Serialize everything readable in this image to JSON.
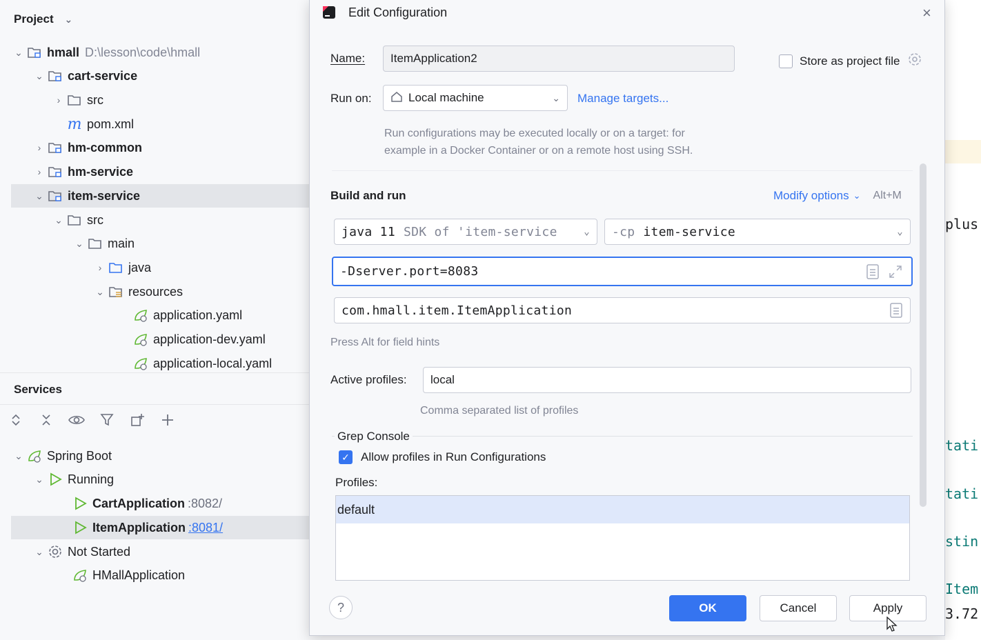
{
  "project_panel": {
    "title": "Project",
    "tree": [
      {
        "label": "hmall",
        "path": "D:\\lesson\\code\\hmall"
      },
      {
        "label": "cart-service"
      },
      {
        "label": "src"
      },
      {
        "label": "pom.xml"
      },
      {
        "label": "hm-common"
      },
      {
        "label": "hm-service"
      },
      {
        "label": "item-service"
      },
      {
        "label": "src"
      },
      {
        "label": "main"
      },
      {
        "label": "java"
      },
      {
        "label": "resources"
      },
      {
        "label": "application.yaml"
      },
      {
        "label": "application-dev.yaml"
      },
      {
        "label": "application-local.yaml"
      }
    ]
  },
  "services_panel": {
    "title": "Services",
    "tree": [
      {
        "label": "Spring Boot"
      },
      {
        "label": "Running"
      },
      {
        "label": "CartApplication",
        "port": ":8082/"
      },
      {
        "label": "ItemApplication",
        "port": ":8081/"
      },
      {
        "label": "Not Started"
      },
      {
        "label": "HMallApplication"
      }
    ]
  },
  "dialog": {
    "title": "Edit Configuration",
    "name_label": "Name:",
    "name_value": "ItemApplication2",
    "store_label": "Store as project file",
    "run_on_label": "Run on:",
    "run_on_value": "Local machine",
    "manage_targets": "Manage targets...",
    "run_on_hint_1": "Run configurations may be executed locally or on a target: for",
    "run_on_hint_2": "example in a Docker Container or on a remote host using SSH.",
    "build_run_title": "Build and run",
    "modify_options": "Modify options",
    "modify_shortcut": "Alt+M",
    "sdk_java": "java 11",
    "sdk_detail": "SDK of 'item-service",
    "cp_prefix": "-cp",
    "cp_value": "item-service",
    "vm_options": "-Dserver.port=8083",
    "main_class": "com.hmall.item.ItemApplication",
    "field_hints": "Press Alt for field hints",
    "active_profiles_label": "Active profiles:",
    "active_profiles_value": "local",
    "active_profiles_hint": "Comma separated list of profiles",
    "grep_title": "Grep Console",
    "allow_profiles_label": "Allow profiles in Run Configurations",
    "profiles_label": "Profiles:",
    "profiles_list": [
      "default"
    ],
    "ok": "OK",
    "cancel": "Cancel",
    "apply": "Apply",
    "help": "?",
    "close": "×"
  },
  "editor_fragments": [
    "plus.",
    "tati",
    "tati",
    "stin",
    "Item",
    "3.72"
  ]
}
